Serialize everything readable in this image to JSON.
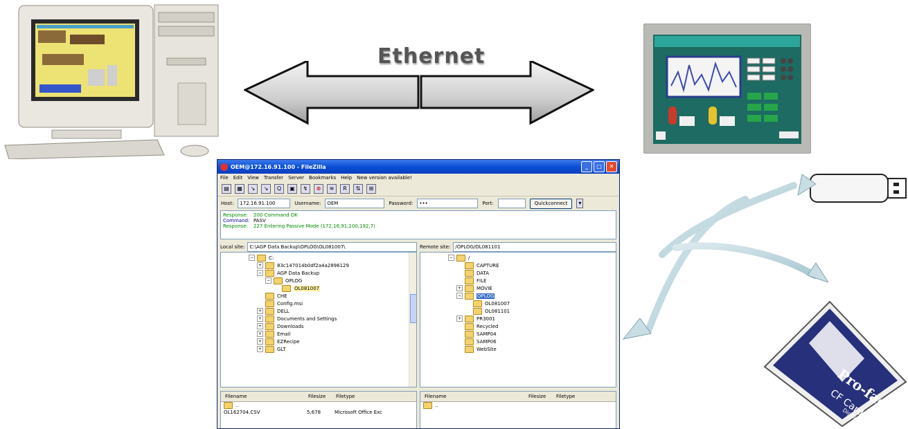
{
  "diagram": {
    "link_label": "Ethernet"
  },
  "cf_card": {
    "brand_line1": "Pro-face",
    "brand_line2": "CF Card",
    "maker": "Digital"
  },
  "filezilla": {
    "title": "OEM@172.16.91.100 - FileZilla",
    "menu": [
      "File",
      "Edit",
      "View",
      "Transfer",
      "Server",
      "Bookmarks",
      "Help",
      "New version available!"
    ],
    "host_label": "Host:",
    "host_value": "172.16.91.100",
    "username_label": "Username:",
    "username_value": "OEM",
    "password_label": "Password:",
    "password_value": "•••",
    "port_label": "Port:",
    "port_value": "",
    "quickconnect_label": "Quickconnect",
    "log": [
      {
        "kind": "Response:",
        "msg": "200 Command OK"
      },
      {
        "kind": "Command:",
        "msg": "PASV"
      },
      {
        "kind": "Response:",
        "msg": "227 Entering Passive Mode (172,16,91,100,192,7)"
      }
    ],
    "local_site_label": "Local site:",
    "local_site_value": "C:\\AGP Data Backup\\OPLOG\\OL081007\\",
    "remote_site_label": "Remote site:",
    "remote_site_value": "/OPLOG/OL081101",
    "local_tree": [
      {
        "label": "C:",
        "indent": 0,
        "state": "expanded"
      },
      {
        "label": "83c147014b0df2a4a2896129",
        "indent": 1,
        "state": "collapsed"
      },
      {
        "label": "AGP Data Backup",
        "indent": 1,
        "state": "expanded"
      },
      {
        "label": "OPLOG",
        "indent": 2,
        "state": "expanded"
      },
      {
        "label": "OL081007",
        "indent": 3,
        "state": "hl"
      },
      {
        "label": "CHE",
        "indent": 1,
        "state": "leaf"
      },
      {
        "label": "Config.msi",
        "indent": 1,
        "state": "leaf"
      },
      {
        "label": "DELL",
        "indent": 1,
        "state": "collapsed"
      },
      {
        "label": "Documents and Settings",
        "indent": 1,
        "state": "collapsed"
      },
      {
        "label": "Downloads",
        "indent": 1,
        "state": "collapsed"
      },
      {
        "label": "Email",
        "indent": 1,
        "state": "collapsed"
      },
      {
        "label": "EZRecipe",
        "indent": 1,
        "state": "collapsed"
      },
      {
        "label": "GLT",
        "indent": 1,
        "state": "collapsed"
      }
    ],
    "remote_tree": [
      {
        "label": "/",
        "indent": 0,
        "state": "expanded"
      },
      {
        "label": "CAPTURE",
        "indent": 1,
        "state": "leaf"
      },
      {
        "label": "DATA",
        "indent": 1,
        "state": "leaf"
      },
      {
        "label": "FILE",
        "indent": 1,
        "state": "leaf"
      },
      {
        "label": "MOVIE",
        "indent": 1,
        "state": "collapsed"
      },
      {
        "label": "OPLOG",
        "indent": 1,
        "state": "sel"
      },
      {
        "label": "OL081007",
        "indent": 2,
        "state": "leaf"
      },
      {
        "label": "OL081101",
        "indent": 2,
        "state": "leaf"
      },
      {
        "label": "PR3001",
        "indent": 1,
        "state": "collapsed"
      },
      {
        "label": "Recycled",
        "indent": 1,
        "state": "leaf"
      },
      {
        "label": "SAMP04",
        "indent": 1,
        "state": "leaf"
      },
      {
        "label": "SAMP06",
        "indent": 1,
        "state": "leaf"
      },
      {
        "label": "WebSite",
        "indent": 1,
        "state": "leaf"
      }
    ],
    "local_files_header": {
      "name": "Filename",
      "size": "Filesize",
      "type": "Filetype"
    },
    "remote_files_header": {
      "name": "Filename",
      "size": "Filesize",
      "type": "Filetype"
    },
    "local_files": [
      {
        "name": "..",
        "size": "",
        "type": ""
      },
      {
        "name": "OL162704.CSV",
        "size": "5,678",
        "type": "Microsoft Office Exc"
      }
    ],
    "remote_files": [
      {
        "name": "..",
        "size": "",
        "type": ""
      }
    ]
  }
}
